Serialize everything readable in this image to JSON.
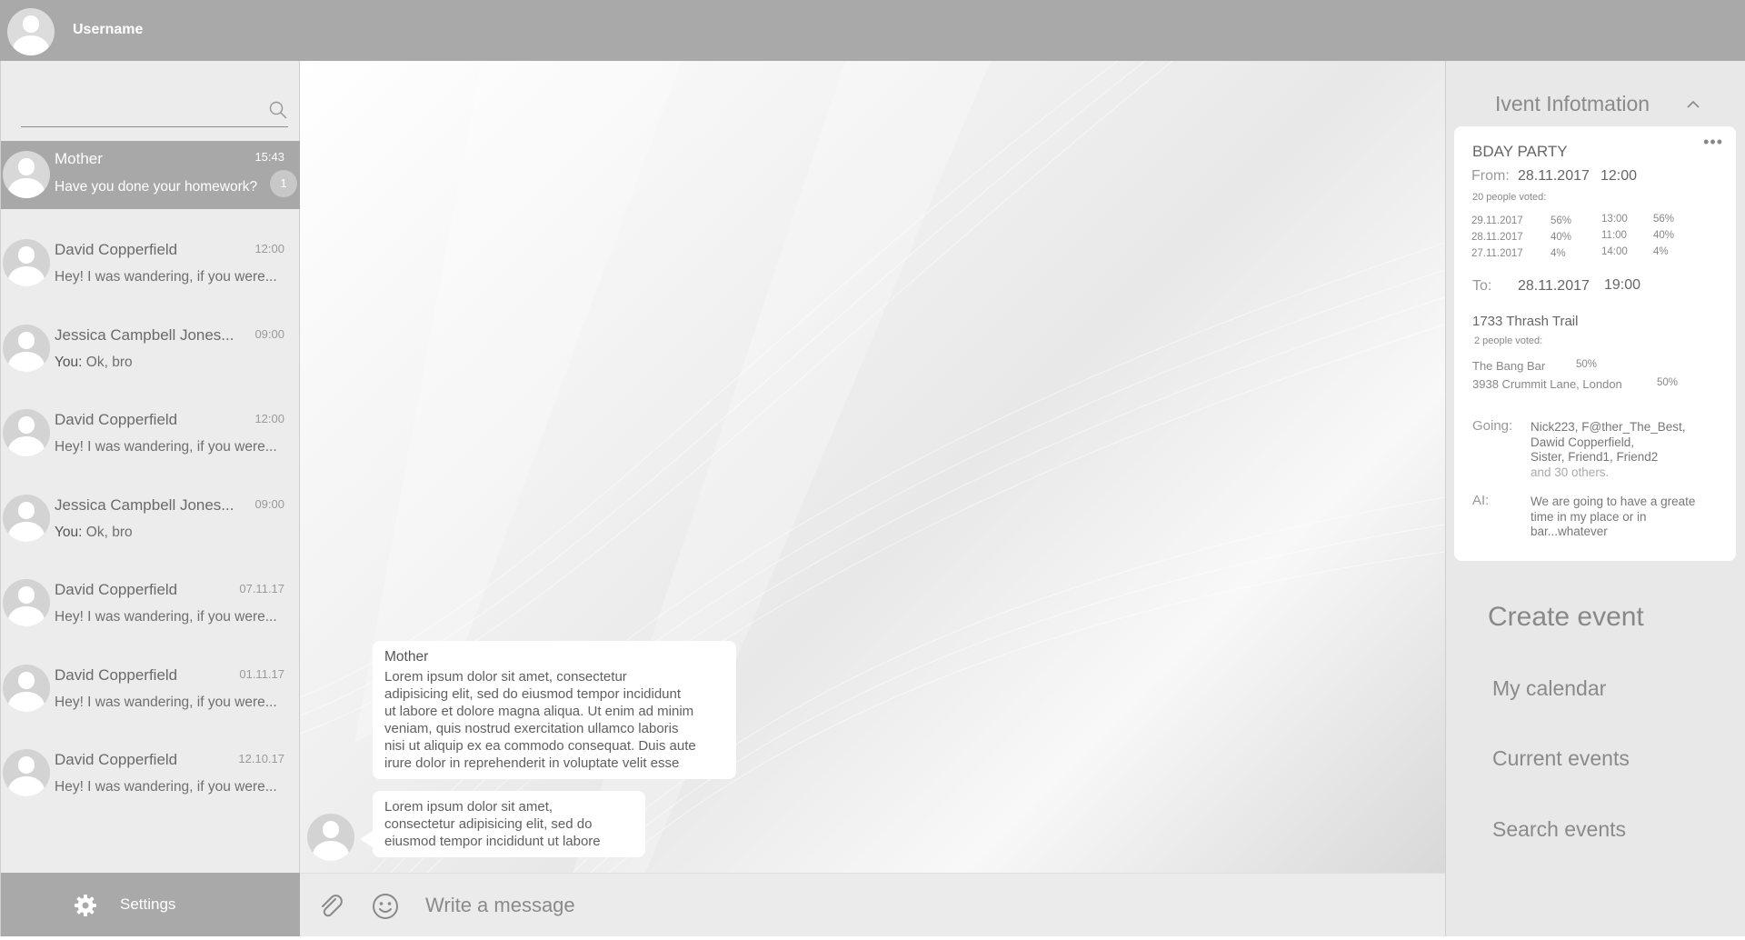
{
  "topbar": {
    "username": "Username"
  },
  "search": {
    "placeholder": ""
  },
  "chats": [
    {
      "name": "Mother",
      "time": "15:43",
      "you": "",
      "preview": "Have you done your homework?",
      "unread": "1"
    },
    {
      "name": "David Copperfield",
      "time": "12:00",
      "you": "",
      "preview": "Hey! I was wandering, if you were..."
    },
    {
      "name": "Jessica Campbell Jones...",
      "time": "09:00",
      "you": "You:",
      "preview": " Ok, bro"
    },
    {
      "name": "David Copperfield",
      "time": "12:00",
      "you": "",
      "preview": "Hey! I was wandering, if you were..."
    },
    {
      "name": "Jessica Campbell Jones...",
      "time": "09:00",
      "you": "You:",
      "preview": " Ok, bro"
    },
    {
      "name": "David Copperfield",
      "time": "07.11.17",
      "you": "",
      "preview": "Hey! I was wandering, if you were..."
    },
    {
      "name": "David Copperfield",
      "time": "01.11.17",
      "you": "",
      "preview": "Hey! I was wandering, if you were..."
    },
    {
      "name": "David Copperfield",
      "time": "12.10.17",
      "you": "",
      "preview": "Hey! I was wandering, if you were..."
    }
  ],
  "settings": {
    "label": "Settings"
  },
  "messages": [
    {
      "sender": "Mother",
      "lines": [
        "Lorem ipsum dolor sit amet, consectetur",
        "adipisicing elit, sed do eiusmod tempor incididunt",
        "ut labore et dolore magna aliqua. Ut enim ad minim",
        "veniam, quis nostrud exercitation ullamco laboris",
        "nisi ut aliquip ex ea commodo consequat. Duis aute",
        "irure dolor in reprehenderit in voluptate velit esse"
      ]
    },
    {
      "sender": "",
      "lines": [
        "Lorem ipsum dolor sit amet,",
        "consectetur adipisicing elit, sed do",
        "eiusmod tempor incididunt ut labore"
      ]
    }
  ],
  "composer": {
    "placeholder": "Write a message"
  },
  "event": {
    "header": "Ivent Infotmation",
    "title": "BDAY PARTY",
    "from_label": "From:",
    "from_date": "28.11.2017",
    "from_time": "12:00",
    "date_votes_label": "20 people voted:",
    "date_votes": [
      {
        "date": "29.11.2017",
        "date_pct": "56%",
        "time": "13:00",
        "time_pct": "56%"
      },
      {
        "date": "28.11.2017",
        "date_pct": "40%",
        "time": "11:00",
        "time_pct": "40%"
      },
      {
        "date": "27.11.2017",
        "date_pct": "4%",
        "time": "14:00",
        "time_pct": "4%"
      }
    ],
    "to_label": "To:",
    "to_date": "28.11.2017",
    "to_time": "19:00",
    "location": "1733 Thrash Trail",
    "location_votes_label": "2 people voted:",
    "location_votes": [
      {
        "place": "The Bang Bar",
        "pct": "50%"
      },
      {
        "place": "3938 Crummit Lane, London",
        "pct": "50%"
      }
    ],
    "going_label": "Going:",
    "going_lines": [
      "Nick223, F@ther_The_Best,",
      "Dawid Copperfield,",
      "Sister, Friend1,  Friend2"
    ],
    "going_more": "and 30 others.",
    "ai_label": "AI:",
    "ai_lines": [
      "We are going to have a greate",
      "time in my place or in",
      "bar...whatever"
    ]
  },
  "side_menu": {
    "create_event": "Create  event",
    "my_calendar": "My calendar",
    "current_events": "Current events",
    "search_events": "Search events"
  }
}
